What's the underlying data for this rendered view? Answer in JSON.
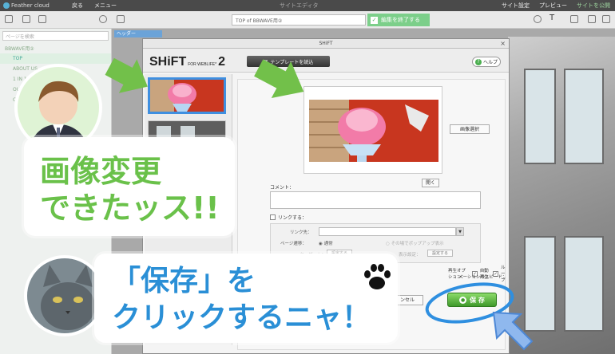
{
  "app": {
    "logo": "Feather cloud",
    "back": "戻る",
    "menu": "メニュー",
    "center_title": "サイトエディタ",
    "site_settings": "サイト設定",
    "preview": "プレビュー",
    "publish": "サイトを公開"
  },
  "toolbar": {
    "url": "TOP of BBWAVE用②",
    "edit_done": "編集を終了する"
  },
  "sidebar": {
    "search_placeholder": "ページを検索",
    "items": [
      {
        "label": "BBWAVE用②"
      },
      {
        "label": "TOP"
      },
      {
        "label": "ABOUT US"
      },
      {
        "label": "1 IN 1 OUT"
      },
      {
        "label": "OUR"
      },
      {
        "label": "C"
      }
    ]
  },
  "canvas": {
    "header_tag": "ヘッダー"
  },
  "modal": {
    "title": "SHiFT",
    "close": "×",
    "logo_main": "SHiFT",
    "logo_small": "FOR WEBLIFE*",
    "logo_num": "2",
    "template_button": "テンプレートを読込",
    "help_button": "ヘルプ",
    "image_select_button": "画像選択",
    "open_button": "開く",
    "comment_label": "コメント：",
    "link_label": "リンクする：",
    "link_url_label": "リンク先：",
    "page_transition_label": "ページ遷移：",
    "normal_option": "通常",
    "popup_option": "その場でポップアップ表示",
    "target_label": "ターゲット：",
    "setting_button": "設定する",
    "display_setting_label": "表示設定：",
    "options_label": "再生オプション：",
    "autoplay": "自動再生",
    "loop": "ループ",
    "speed_label": "メーションのスピード：",
    "cancel_button": "ンセル",
    "save_button": "保 存"
  },
  "callouts": {
    "bubble_1_line1": "画像変更",
    "bubble_1_line2": "できたッス!!",
    "bubble_2_line1": "「保存」を",
    "bubble_2_line2": "クリックするニャ！"
  },
  "colors": {
    "accent_green": "#6ac14a",
    "accent_blue": "#2a8fd6",
    "save_green": "#3f9a2b"
  }
}
